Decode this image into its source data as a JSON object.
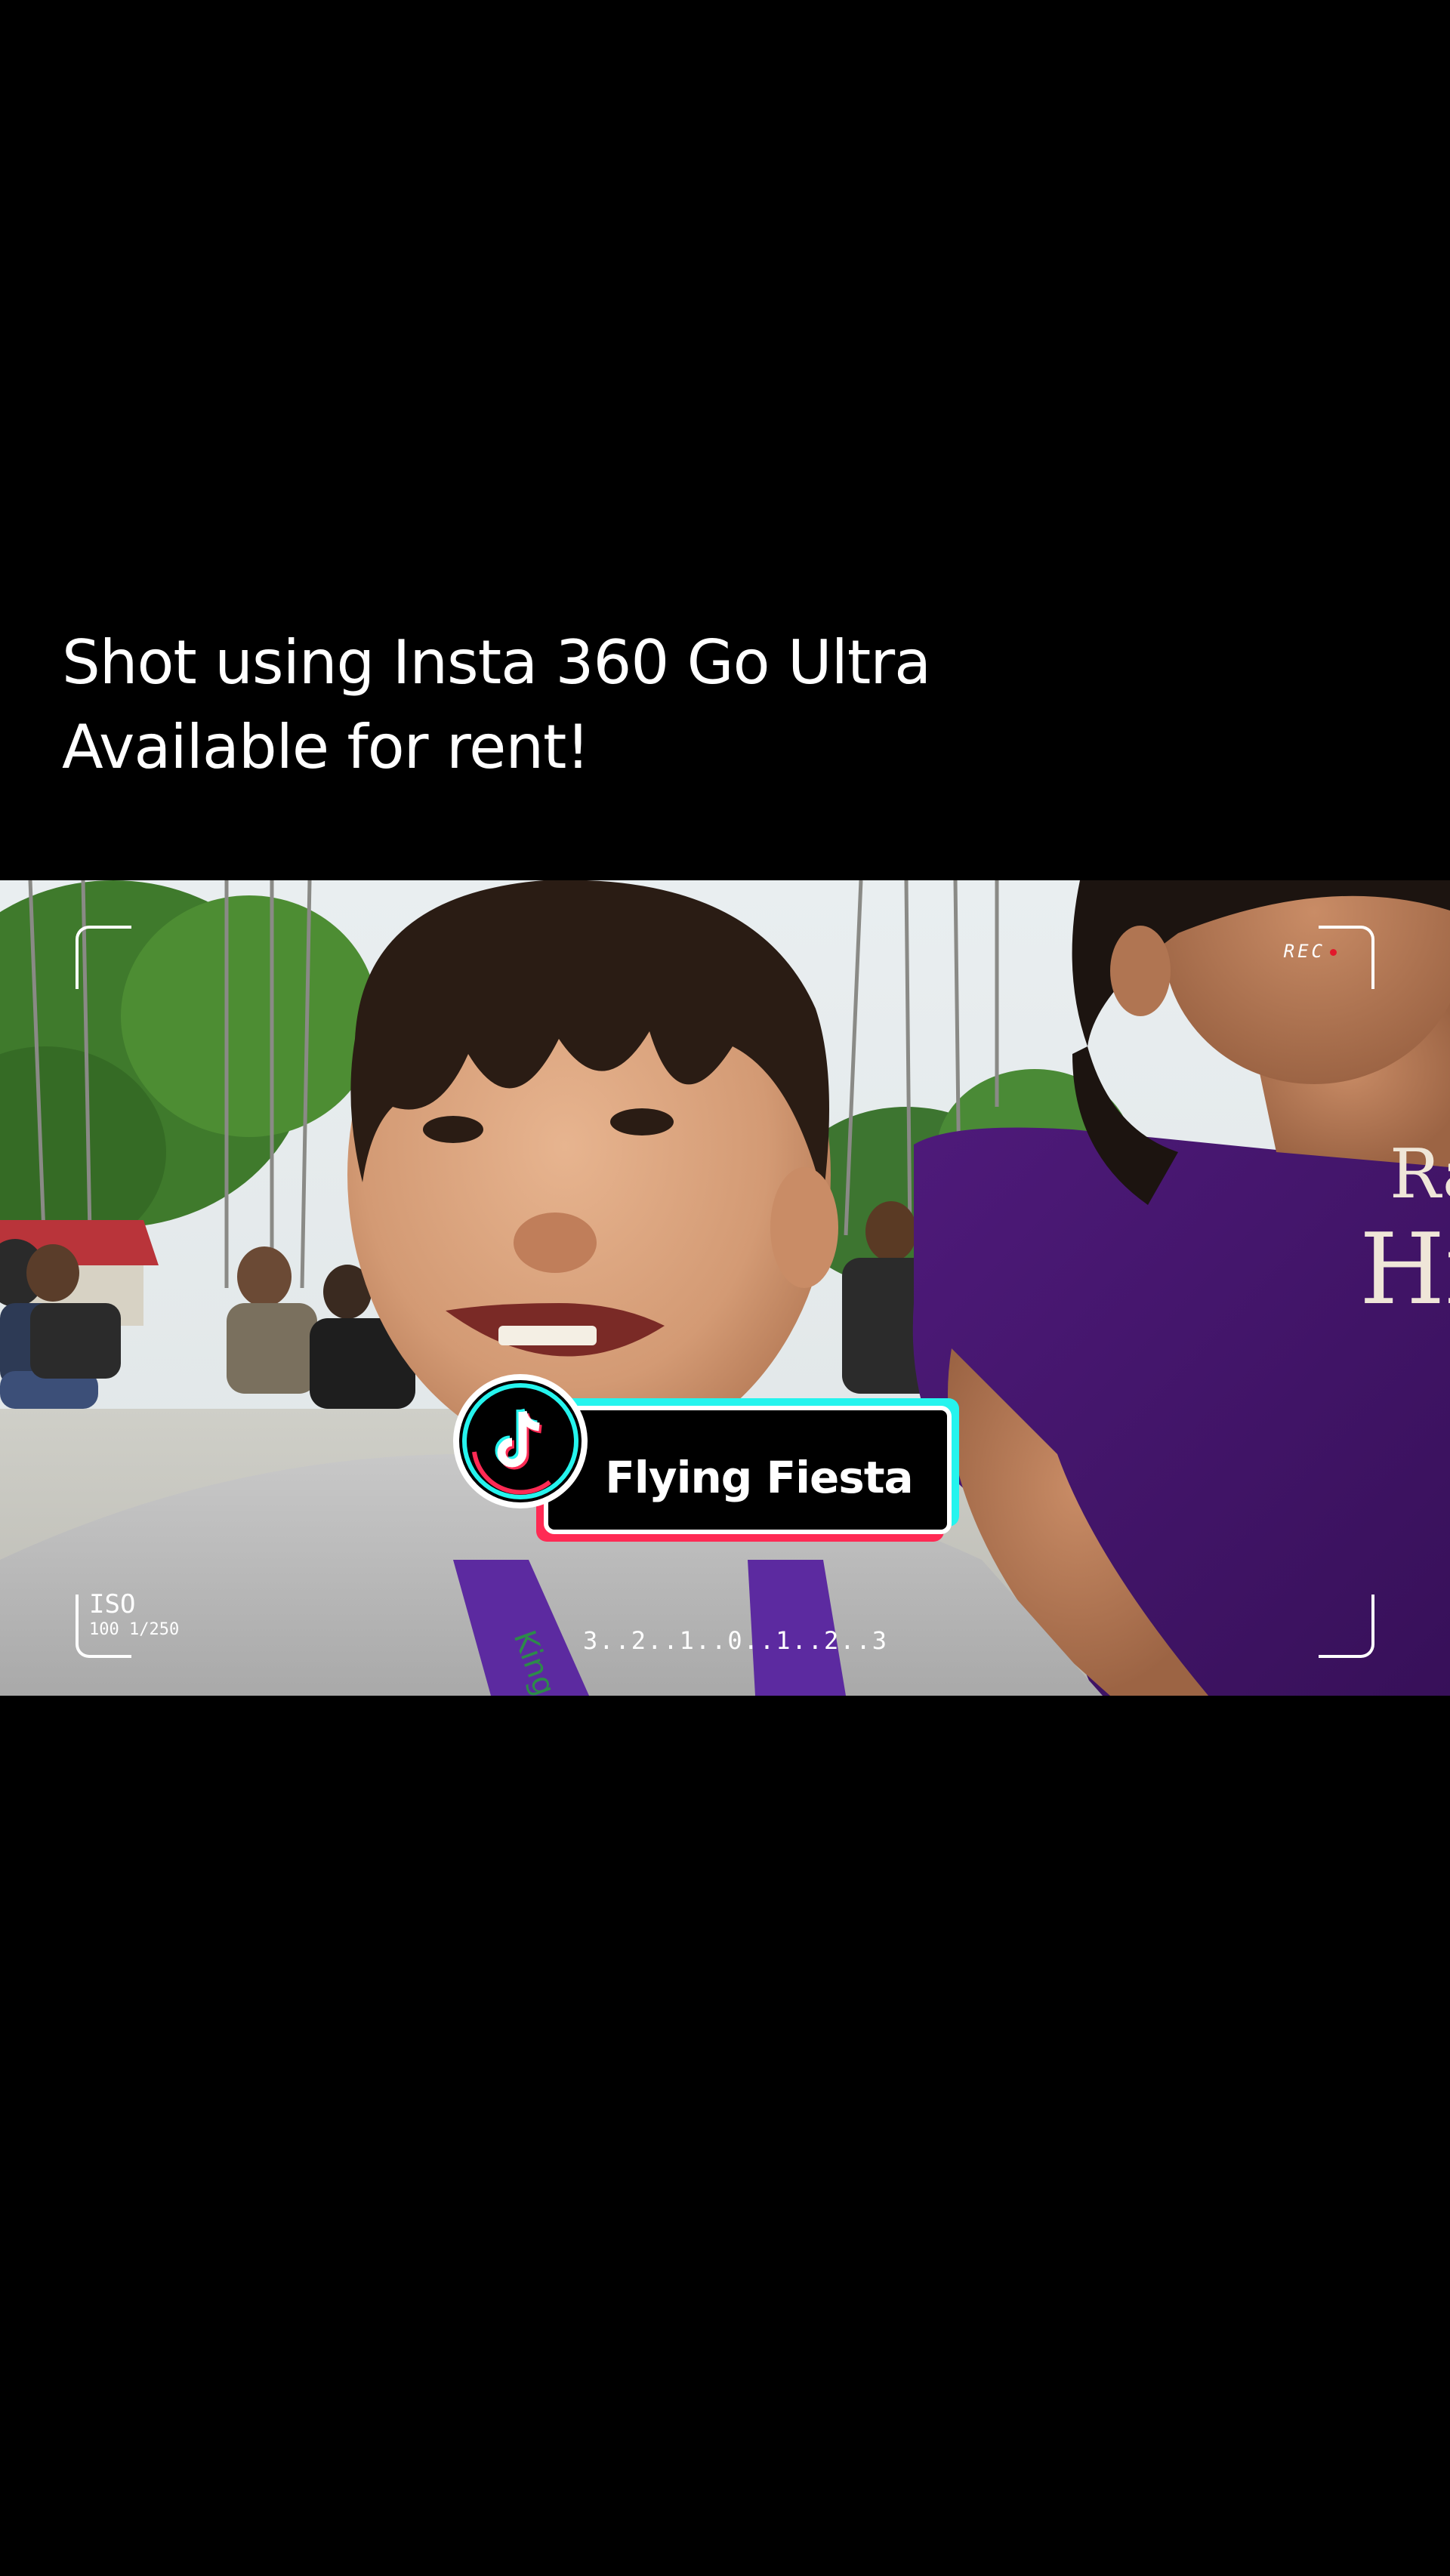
{
  "caption": {
    "line1": "Shot using Insta 360 Go Ultra",
    "line2": "Available for rent!"
  },
  "camera_overlay": {
    "rec_label": "REC",
    "iso_label": "ISO",
    "iso_values": "100  1/250",
    "exposure_scale": "3..2..1..0..1..2..3"
  },
  "sticker": {
    "label": "Flying Fiesta",
    "icon": "tiktok-logo-icon"
  },
  "colors": {
    "background": "#000000",
    "sticker_cyan": "#25f4ee",
    "sticker_pink": "#ff2a54",
    "rec_dot": "#e2192b"
  }
}
